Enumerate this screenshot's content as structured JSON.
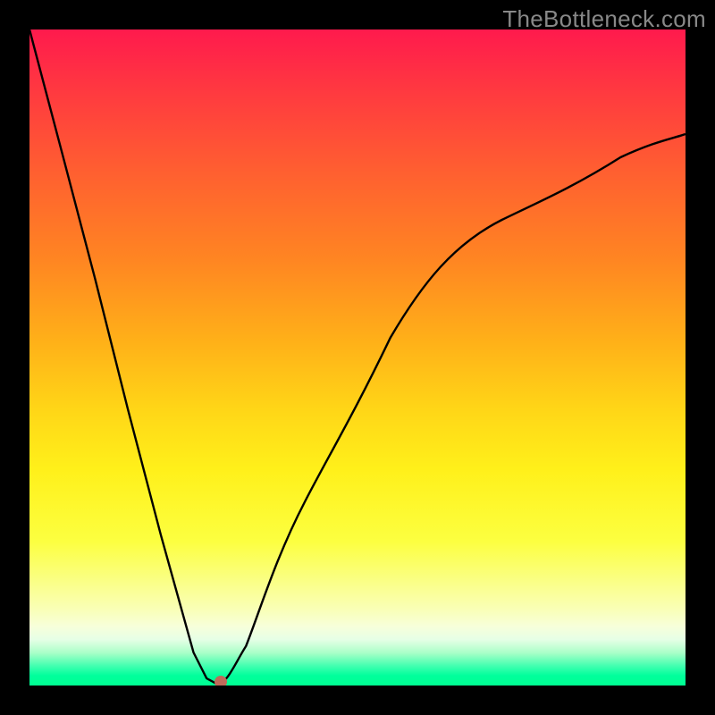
{
  "watermark_text": "TheBottleneck.com",
  "chart_data": {
    "type": "line",
    "title": "",
    "xlabel": "",
    "ylabel": "",
    "xlim": [
      0,
      1
    ],
    "ylim": [
      0,
      1
    ],
    "grid": false,
    "legend": false,
    "series": [
      {
        "name": "curve",
        "x": [
          0.0,
          0.05,
          0.1,
          0.15,
          0.2,
          0.25,
          0.27,
          0.29,
          0.3,
          0.33,
          0.37,
          0.42,
          0.48,
          0.55,
          0.63,
          0.72,
          0.82,
          0.92,
          1.0
        ],
        "y": [
          1.0,
          0.81,
          0.62,
          0.42,
          0.23,
          0.05,
          0.01,
          0.0,
          0.01,
          0.06,
          0.16,
          0.28,
          0.41,
          0.53,
          0.63,
          0.71,
          0.77,
          0.82,
          0.84
        ]
      }
    ],
    "marker": {
      "x": 0.29,
      "y": 0.0,
      "color": "#bf6a5a"
    },
    "gradient_stops": [
      {
        "pos": 0.0,
        "color": "#ff1a4d"
      },
      {
        "pos": 0.1,
        "color": "#ff3b3f"
      },
      {
        "pos": 0.22,
        "color": "#ff6030"
      },
      {
        "pos": 0.35,
        "color": "#ff8522"
      },
      {
        "pos": 0.48,
        "color": "#ffb218"
      },
      {
        "pos": 0.58,
        "color": "#ffd617"
      },
      {
        "pos": 0.67,
        "color": "#fff01a"
      },
      {
        "pos": 0.78,
        "color": "#fcff40"
      },
      {
        "pos": 0.885,
        "color": "#f9ffb8"
      },
      {
        "pos": 0.91,
        "color": "#f7ffda"
      },
      {
        "pos": 0.93,
        "color": "#e6ffe6"
      },
      {
        "pos": 0.95,
        "color": "#aaffc8"
      },
      {
        "pos": 0.97,
        "color": "#42ffb0"
      },
      {
        "pos": 0.985,
        "color": "#00ff9c"
      },
      {
        "pos": 1.0,
        "color": "#00ff92"
      }
    ]
  }
}
